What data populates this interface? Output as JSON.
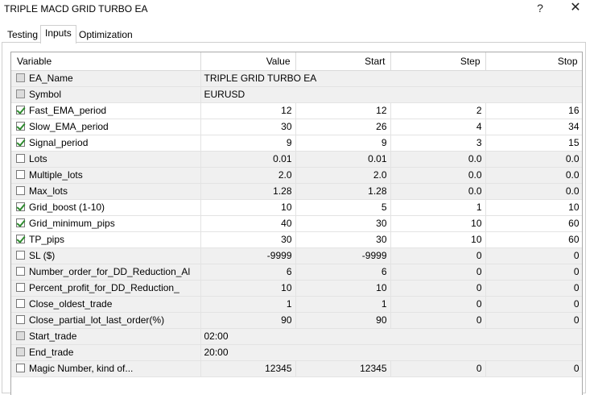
{
  "window": {
    "title": "TRIPLE MACD GRID TURBO EA",
    "help_glyph": "?",
    "close_glyph": "✕"
  },
  "tabs": [
    {
      "label": "Testing",
      "active": false
    },
    {
      "label": "Inputs",
      "active": true
    },
    {
      "label": "Optimization",
      "active": false
    }
  ],
  "grid": {
    "headers": [
      "Variable",
      "Value",
      "Start",
      "Step",
      "Stop"
    ],
    "rows": [
      {
        "name": "EA_Name",
        "checked": false,
        "disabled": true,
        "value": "TRIPLE GRID TURBO EA",
        "text": true
      },
      {
        "name": "Symbol",
        "checked": false,
        "disabled": true,
        "value": "EURUSD",
        "text": true
      },
      {
        "name": "Fast_EMA_period",
        "checked": true,
        "value": "12",
        "start": "12",
        "step": "2",
        "stop": "16"
      },
      {
        "name": "Slow_EMA_period",
        "checked": true,
        "value": "30",
        "start": "26",
        "step": "4",
        "stop": "34"
      },
      {
        "name": "Signal_period",
        "checked": true,
        "value": "9",
        "start": "9",
        "step": "3",
        "stop": "15"
      },
      {
        "name": "Lots",
        "checked": false,
        "value": "0.01",
        "start": "0.01",
        "step": "0.0",
        "stop": "0.0"
      },
      {
        "name": "Multiple_lots",
        "checked": false,
        "value": "2.0",
        "start": "2.0",
        "step": "0.0",
        "stop": "0.0"
      },
      {
        "name": "Max_lots",
        "checked": false,
        "value": "1.28",
        "start": "1.28",
        "step": "0.0",
        "stop": "0.0"
      },
      {
        "name": "Grid_boost (1-10)",
        "checked": true,
        "value": "10",
        "start": "5",
        "step": "1",
        "stop": "10"
      },
      {
        "name": "Grid_minimum_pips",
        "checked": true,
        "value": "40",
        "start": "30",
        "step": "10",
        "stop": "60"
      },
      {
        "name": "TP_pips",
        "checked": true,
        "value": "30",
        "start": "30",
        "step": "10",
        "stop": "60"
      },
      {
        "name": "SL ($)",
        "checked": false,
        "value": "-9999",
        "start": "-9999",
        "step": "0",
        "stop": "0"
      },
      {
        "name": "Number_order_for_DD_Reduction_Al",
        "checked": false,
        "value": "6",
        "start": "6",
        "step": "0",
        "stop": "0"
      },
      {
        "name": "Percent_profit_for_DD_Reduction_",
        "checked": false,
        "value": "10",
        "start": "10",
        "step": "0",
        "stop": "0"
      },
      {
        "name": "Close_oldest_trade",
        "checked": false,
        "value": "1",
        "start": "1",
        "step": "0",
        "stop": "0"
      },
      {
        "name": "Close_partial_lot_last_order(%)",
        "checked": false,
        "value": "90",
        "start": "90",
        "step": "0",
        "stop": "0"
      },
      {
        "name": "Start_trade",
        "checked": false,
        "disabled": true,
        "value": "02:00",
        "text": true
      },
      {
        "name": "End_trade",
        "checked": false,
        "disabled": true,
        "value": "20:00",
        "text": true
      },
      {
        "name": "Magic Number, kind of...",
        "checked": false,
        "value": "12345",
        "start": "12345",
        "step": "0",
        "stop": "0"
      }
    ]
  }
}
